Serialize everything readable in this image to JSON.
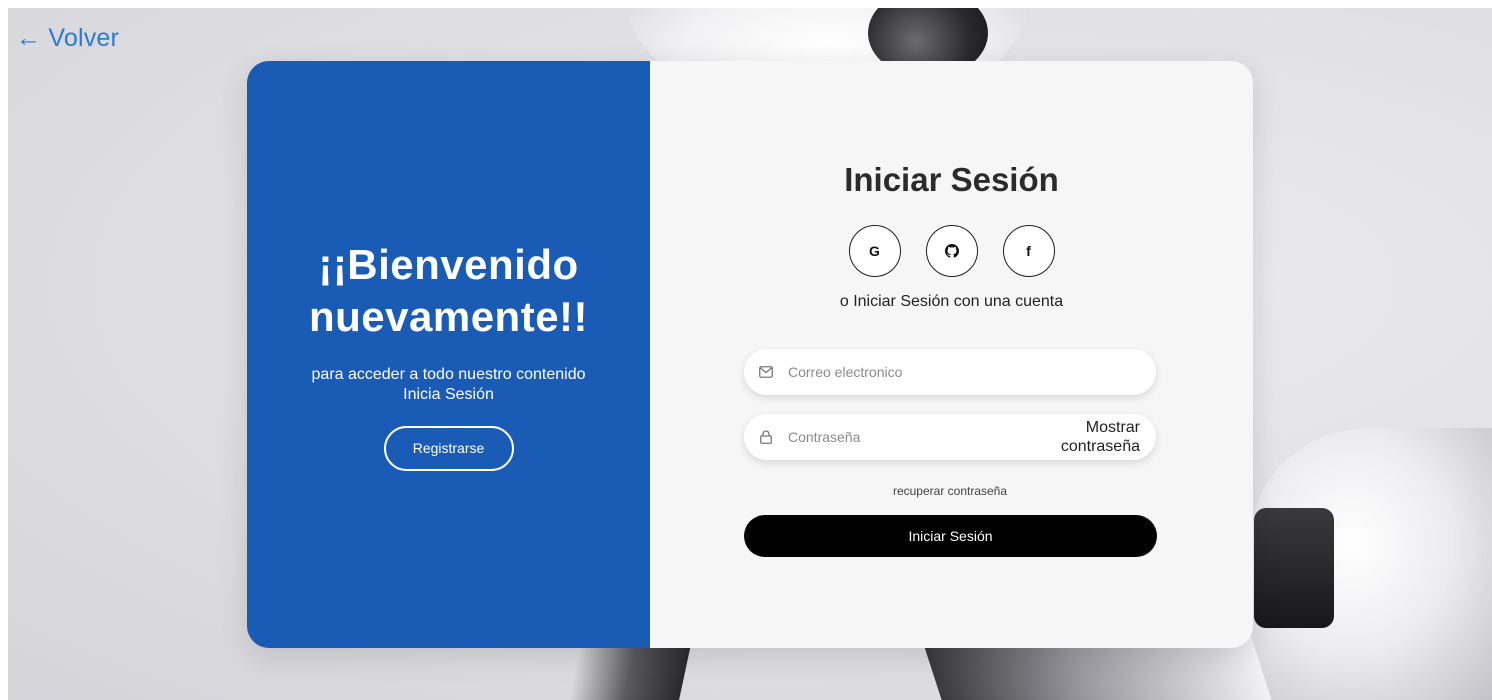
{
  "nav": {
    "back_label": "← Volver"
  },
  "welcome": {
    "title_line1": "¡¡Bienvenido",
    "title_line2": "nuevamente!!",
    "subtitle": "para acceder a todo nuestro contenido Inicia Sesión",
    "register_label": "Registrarse"
  },
  "login": {
    "title": "Iniciar Sesión",
    "socials": [
      {
        "label": "G",
        "icon": "google-icon"
      },
      {
        "label": "",
        "icon": "github-icon"
      },
      {
        "label": "f",
        "icon": "facebook-icon"
      }
    ],
    "alt_text": "o Iniciar Sesión con una cuenta",
    "email_placeholder": "Correo electronico",
    "password_placeholder": "Contraseña",
    "show_password_label": "Mostrar contraseña",
    "recover_label": "recuperar contraseña",
    "submit_label": "Iniciar Sesión"
  },
  "colors": {
    "accent_blue": "#1a5bb5",
    "link_blue": "#2a7bd4",
    "button_black": "#000000",
    "panel_bg": "#f6f6f6"
  }
}
